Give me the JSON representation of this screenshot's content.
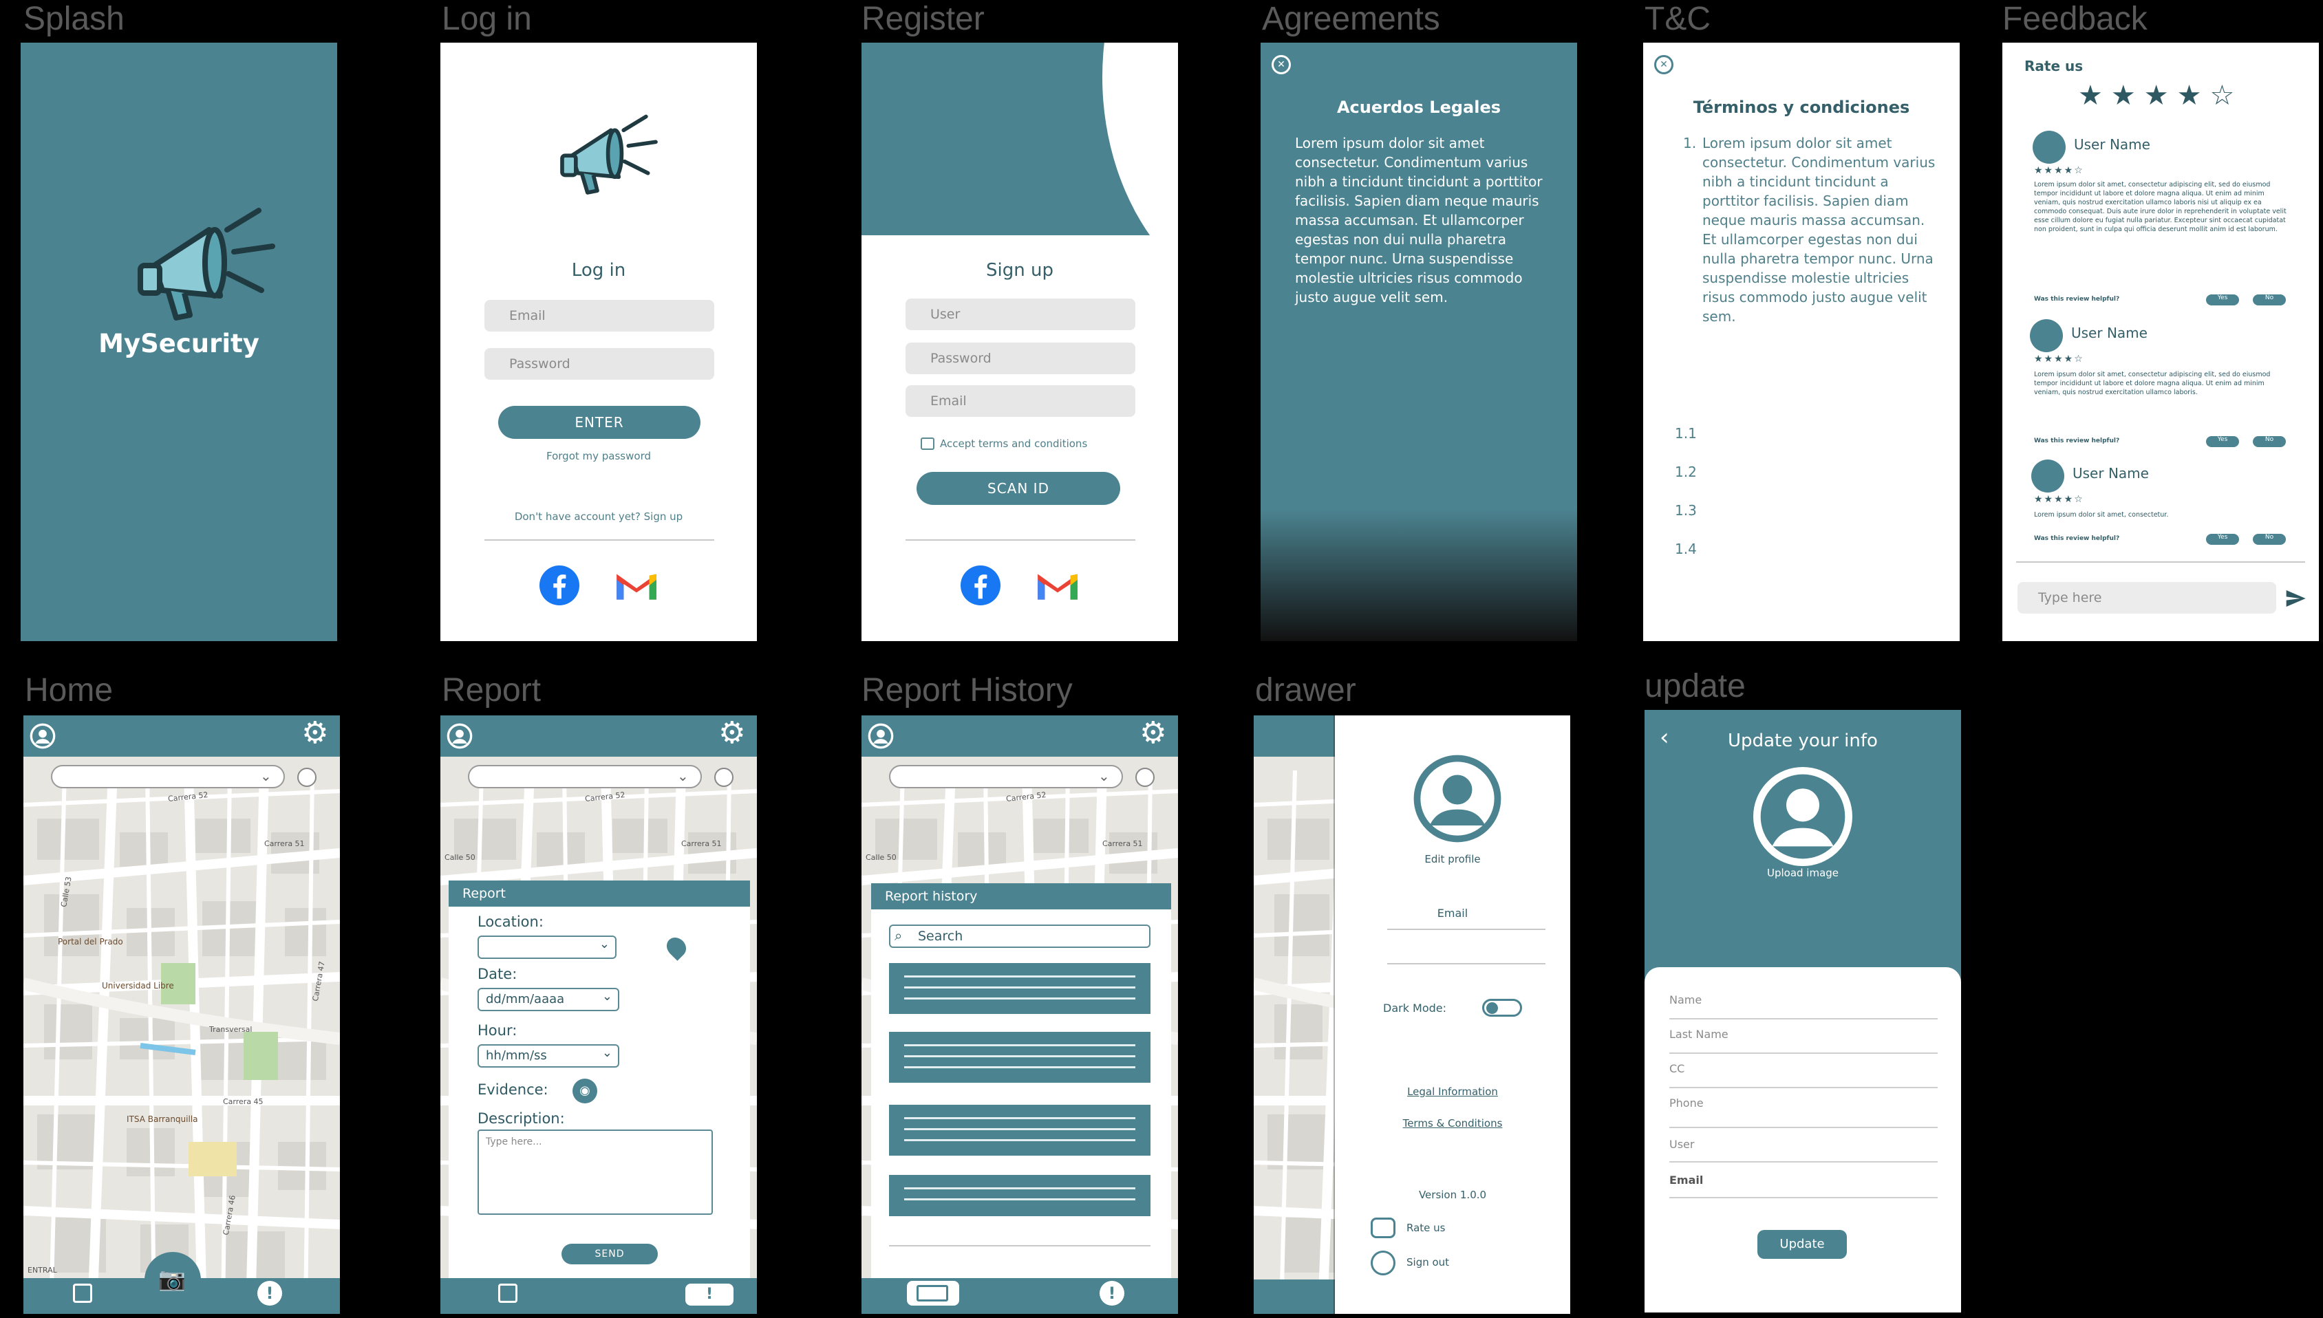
{
  "labels": {
    "splash": "Splash",
    "login": "Log in",
    "register": "Register",
    "agreements": "Agreements",
    "tc": "T&C",
    "feedback": "Feedback",
    "home": "Home",
    "report": "Report",
    "history": "Report History",
    "drawer": "drawer",
    "update": "update"
  },
  "splash": {
    "app_name": "MySecurity"
  },
  "login": {
    "title": "Log in",
    "email_ph": "Email",
    "password_ph": "Password",
    "enter": "ENTER",
    "forgot": "Forgot my password",
    "no_account": "Don't have account yet? Sign up"
  },
  "register": {
    "title": "Sign up",
    "user_ph": "User",
    "password_ph": "Password",
    "email_ph": "Email",
    "accept": "Accept terms and conditions",
    "scan": "SCAN ID"
  },
  "agreements": {
    "title": "Acuerdos Legales",
    "body": "Lorem ipsum dolor sit amet consectetur. Condimentum varius nibh a tincidunt tincidunt a porttitor facilisis. Sapien diam neque mauris massa accumsan. Et ullamcorper egestas non dui nulla pharetra tempor nunc. Urna suspendisse molestie ultricies risus commodo justo augue velit sem."
  },
  "tc": {
    "title": "Términos y condiciones",
    "item1_num": "1.",
    "item1": "Lorem ipsum dolor sit amet consectetur. Condimentum varius nibh a tincidunt tincidunt a porttitor facilisis. Sapien diam neque mauris massa accumsan. Et ullamcorper egestas non dui nulla pharetra tempor nunc. Urna suspendisse molestie ultricies risus commodo justo augue velit sem.",
    "subitems": [
      "1.1",
      "1.2",
      "1.3",
      "1.4"
    ]
  },
  "feedback": {
    "title": "Rate us",
    "stars": 4,
    "max_stars": 5,
    "input_ph": "Type here",
    "reviews": [
      {
        "user": "User Name",
        "stars": "★★★★☆",
        "text": "Lorem ipsum dolor sit amet, consectetur adipiscing elit, sed do eiusmod tempor incididunt ut labore et dolore magna aliqua. Ut enim ad minim veniam, quis nostrud exercitation ullamco laboris nisi ut aliquip ex ea commodo consequat. Duis aute irure dolor in reprehenderit in voluptate velit esse cillum dolore eu fugiat nulla pariatur. Excepteur sint occaecat cupidatat non proident, sunt in culpa qui officia deserunt mollit anim id est laborum.",
        "helpful": "Was this review helpful?",
        "yes": "Yes",
        "no": "No"
      },
      {
        "user": "User Name",
        "stars": "★★★★☆",
        "text": "Lorem ipsum dolor sit amet, consectetur adipiscing elit, sed do eiusmod tempor incididunt ut labore et dolore magna aliqua. Ut enim ad minim veniam, quis nostrud exercitation ullamco laboris.",
        "helpful": "Was this review helpful?",
        "yes": "Yes",
        "no": "No"
      },
      {
        "user": "User Name",
        "stars": "★★★★☆",
        "text": "Lorem ipsum dolor sit amet, consectetur.",
        "helpful": "Was this review helpful?",
        "yes": "Yes",
        "no": "No"
      }
    ]
  },
  "map": {
    "streets": [
      "Carrera 52",
      "Carrera 51",
      "Calle 53",
      "Carrera 47",
      "Transversal",
      "Calle 50",
      "Carrera 45",
      "Carrera 46",
      "ENTRAL"
    ],
    "places": [
      "Portal del Prado",
      "Universidad Libre",
      "ITSA Barranquilla"
    ]
  },
  "report": {
    "title": "Report",
    "location": "Location:",
    "date": "Date:",
    "date_ph": "dd/mm/aaaa",
    "hour": "Hour:",
    "hour_ph": "hh/mm/ss",
    "evidence": "Evidence:",
    "description": "Description:",
    "desc_ph": "Type here...",
    "send": "SEND"
  },
  "history": {
    "title": "Report history",
    "search_ph": "Search",
    "rows": 4
  },
  "drawer": {
    "edit_profile": "Edit profile",
    "email": "Email",
    "dark_mode": "Dark Mode:",
    "legal": "Legal Information",
    "terms": "Terms & Conditions",
    "version": "Version 1.0.0",
    "rate": "Rate us",
    "signout": "Sign out"
  },
  "update": {
    "title": "Update your info",
    "upload": "Upload image",
    "fields": [
      "Name",
      "Last Name",
      "CC",
      "Phone",
      "User",
      "Email"
    ],
    "button": "Update"
  },
  "colors": {
    "teal": "#4b8390",
    "facebook": "#1877f2",
    "gmail_red": "#ea4335"
  }
}
